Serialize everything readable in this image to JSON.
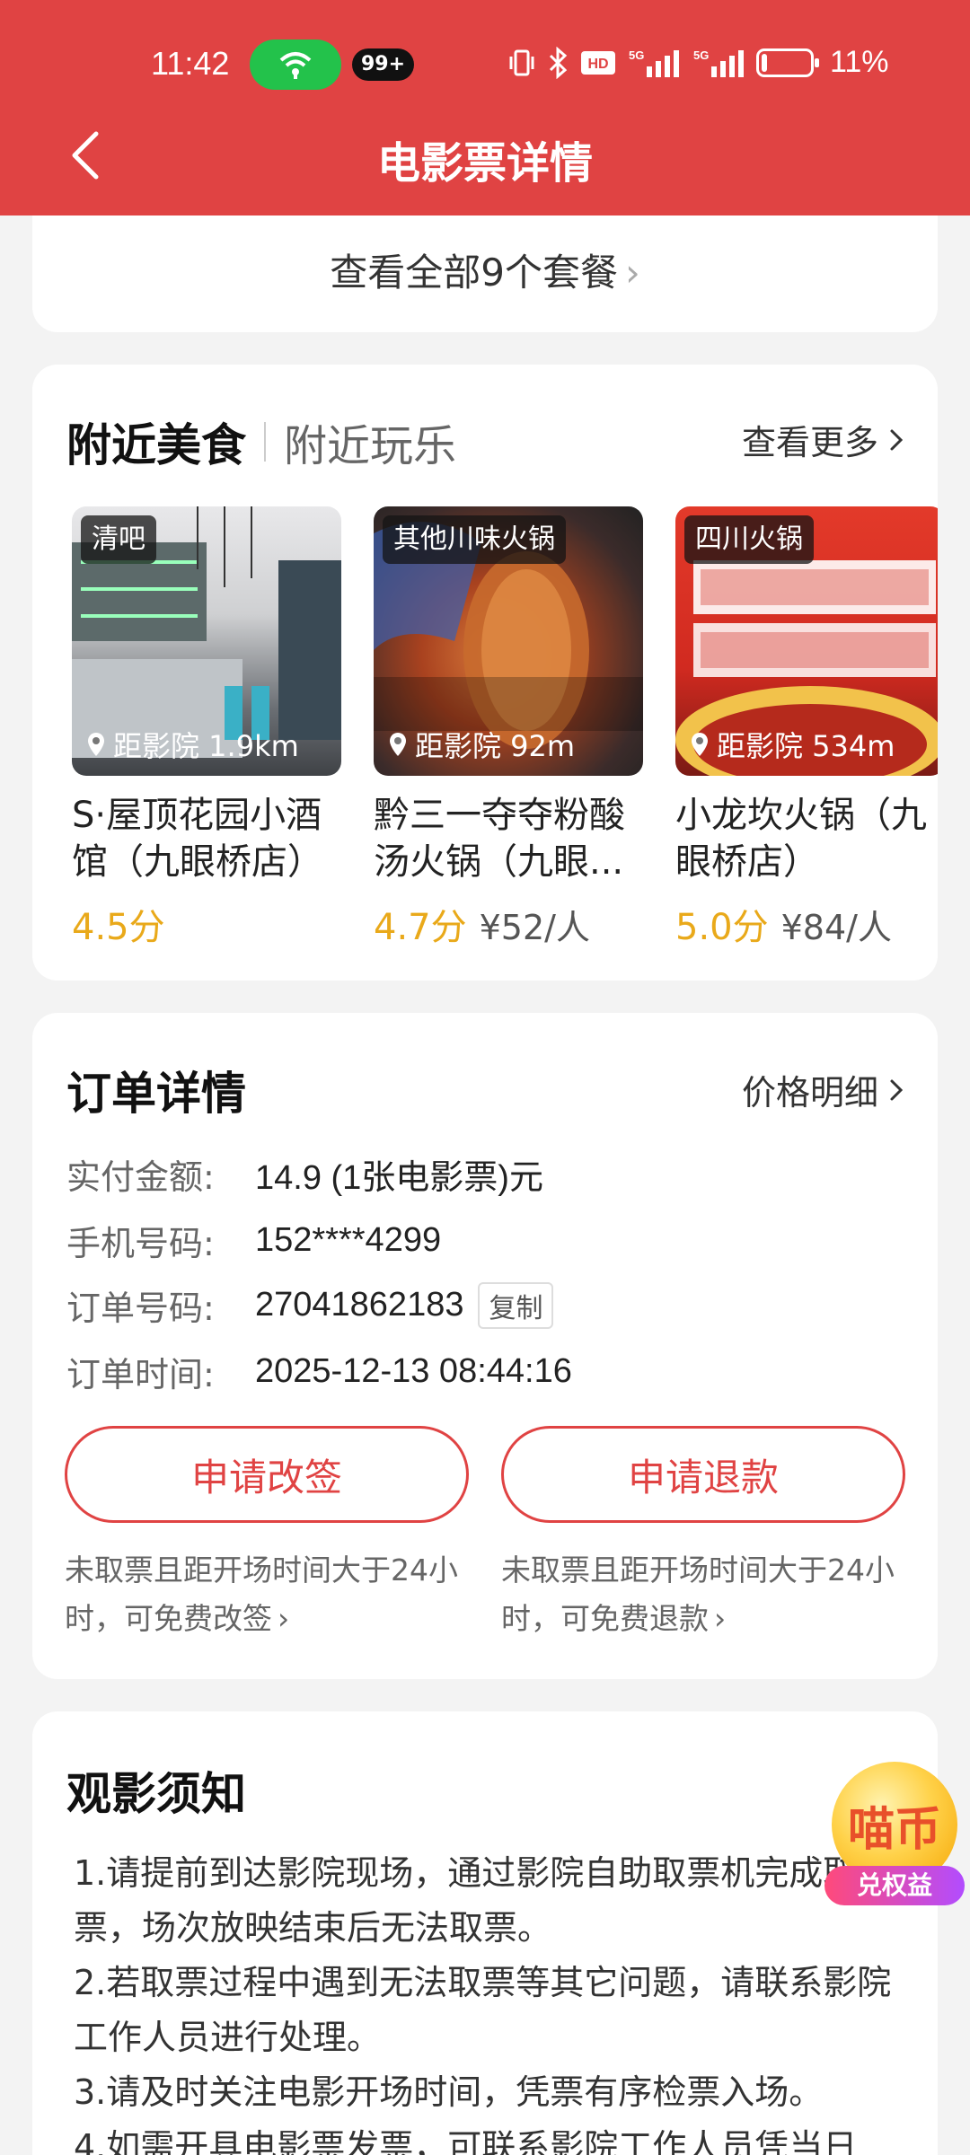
{
  "status_bar": {
    "time": "11:42",
    "badge": "99+",
    "battery": "11%",
    "battery_level": 0.11,
    "network_labels": [
      "5G",
      "5G"
    ]
  },
  "nav": {
    "title": "电影票详情",
    "back_icon": "chevron-left-icon"
  },
  "packages": {
    "view_all": "查看全部9个套餐"
  },
  "nearby": {
    "tab_food": "附近美食",
    "tab_fun": "附近玩乐",
    "see_more": "查看更多",
    "items": [
      {
        "tag": "清吧",
        "distance": "距影院 1.9km",
        "name": "S·屋顶花园小酒馆（九眼桥店）",
        "score": "4.5分",
        "price": ""
      },
      {
        "tag": "其他川味火锅",
        "distance": "距影院 92m",
        "name": "黔三一夺夺粉酸汤火锅（九眼...",
        "score": "4.7分",
        "price": "¥52/人"
      },
      {
        "tag": "四川火锅",
        "distance": "距影院 534m",
        "name": "小龙坎火锅（九眼桥店）",
        "score": "5.0分",
        "price": "¥84/人"
      }
    ]
  },
  "order": {
    "title": "订单详情",
    "price_detail": "价格明细",
    "rows": [
      {
        "label": "实付金额:",
        "value": "14.9 (1张电影票)元"
      },
      {
        "label": "手机号码:",
        "value": "152****4299"
      },
      {
        "label": "订单号码:",
        "value": "27041862183"
      },
      {
        "label": "订单时间:",
        "value": "2025-12-13 08:44:16"
      }
    ],
    "copy_label": "复制",
    "btn_change": "申请改签",
    "btn_refund": "申请退款",
    "note_change": "未取票且距开场时间大于24小时，可免费改签",
    "note_refund": "未取票且距开场时间大于24小时，可免费退款"
  },
  "notice": {
    "title": "观影须知",
    "lines": [
      "1.请提前到达影院现场，通过影院自助取票机完成取票，场次放映结束后无法取票。",
      "2.若取票过程中遇到无法取票等其它问题，请联系影院工作人员进行处理。",
      "3.请及时关注电影开场时间，凭票有序检票入场。",
      "4.如需开具电影票发票，可联系影院工作人员凭当日"
    ]
  },
  "floating": {
    "coin_text": "喵币",
    "coin_label": "兑权益"
  },
  "colors": {
    "brand_red": "#e04343",
    "score_yellow": "#e9a91a",
    "wifi_green": "#23c24b"
  }
}
